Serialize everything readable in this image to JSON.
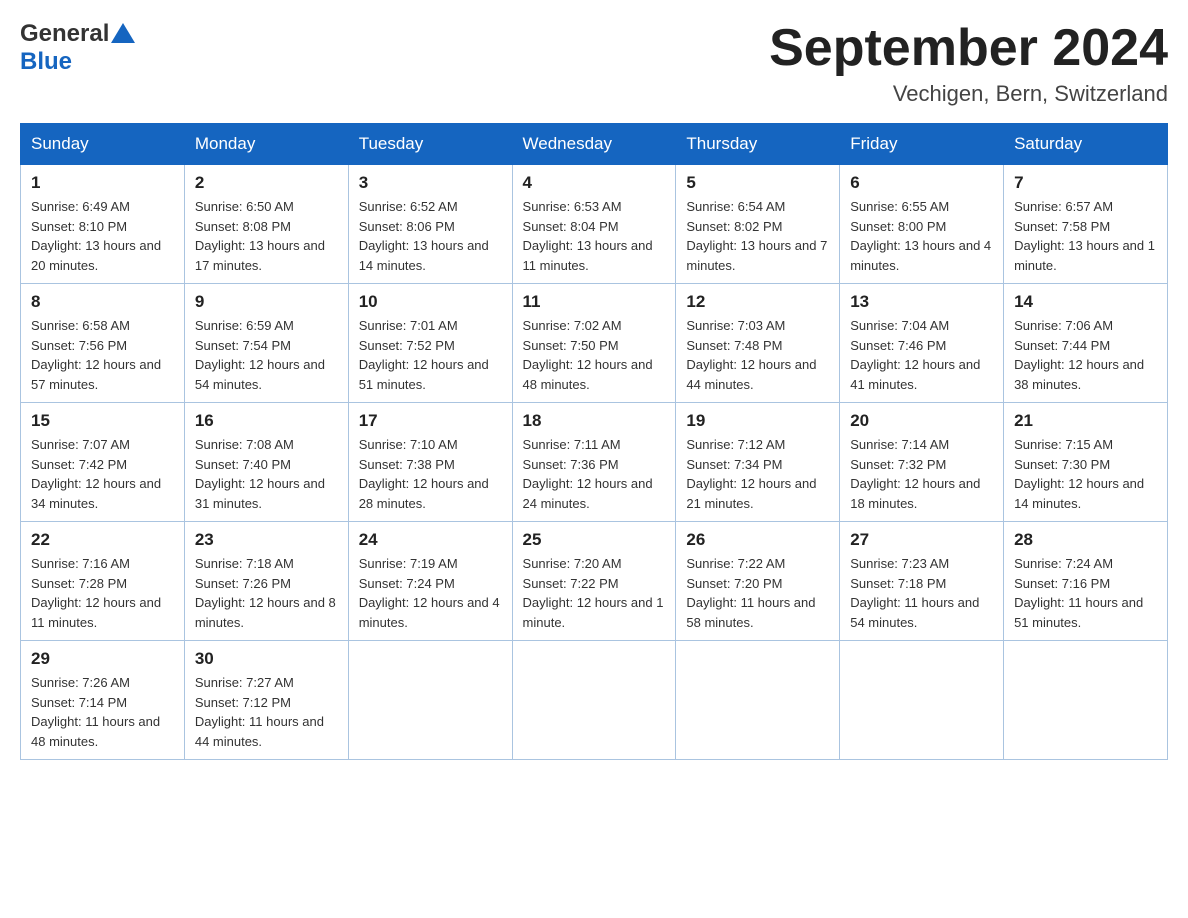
{
  "header": {
    "logo_general": "General",
    "logo_blue": "Blue",
    "title": "September 2024",
    "location": "Vechigen, Bern, Switzerland"
  },
  "days_of_week": [
    "Sunday",
    "Monday",
    "Tuesday",
    "Wednesday",
    "Thursday",
    "Friday",
    "Saturday"
  ],
  "weeks": [
    [
      {
        "day": 1,
        "sunrise": "6:49 AM",
        "sunset": "8:10 PM",
        "daylight": "13 hours and 20 minutes."
      },
      {
        "day": 2,
        "sunrise": "6:50 AM",
        "sunset": "8:08 PM",
        "daylight": "13 hours and 17 minutes."
      },
      {
        "day": 3,
        "sunrise": "6:52 AM",
        "sunset": "8:06 PM",
        "daylight": "13 hours and 14 minutes."
      },
      {
        "day": 4,
        "sunrise": "6:53 AM",
        "sunset": "8:04 PM",
        "daylight": "13 hours and 11 minutes."
      },
      {
        "day": 5,
        "sunrise": "6:54 AM",
        "sunset": "8:02 PM",
        "daylight": "13 hours and 7 minutes."
      },
      {
        "day": 6,
        "sunrise": "6:55 AM",
        "sunset": "8:00 PM",
        "daylight": "13 hours and 4 minutes."
      },
      {
        "day": 7,
        "sunrise": "6:57 AM",
        "sunset": "7:58 PM",
        "daylight": "13 hours and 1 minute."
      }
    ],
    [
      {
        "day": 8,
        "sunrise": "6:58 AM",
        "sunset": "7:56 PM",
        "daylight": "12 hours and 57 minutes."
      },
      {
        "day": 9,
        "sunrise": "6:59 AM",
        "sunset": "7:54 PM",
        "daylight": "12 hours and 54 minutes."
      },
      {
        "day": 10,
        "sunrise": "7:01 AM",
        "sunset": "7:52 PM",
        "daylight": "12 hours and 51 minutes."
      },
      {
        "day": 11,
        "sunrise": "7:02 AM",
        "sunset": "7:50 PM",
        "daylight": "12 hours and 48 minutes."
      },
      {
        "day": 12,
        "sunrise": "7:03 AM",
        "sunset": "7:48 PM",
        "daylight": "12 hours and 44 minutes."
      },
      {
        "day": 13,
        "sunrise": "7:04 AM",
        "sunset": "7:46 PM",
        "daylight": "12 hours and 41 minutes."
      },
      {
        "day": 14,
        "sunrise": "7:06 AM",
        "sunset": "7:44 PM",
        "daylight": "12 hours and 38 minutes."
      }
    ],
    [
      {
        "day": 15,
        "sunrise": "7:07 AM",
        "sunset": "7:42 PM",
        "daylight": "12 hours and 34 minutes."
      },
      {
        "day": 16,
        "sunrise": "7:08 AM",
        "sunset": "7:40 PM",
        "daylight": "12 hours and 31 minutes."
      },
      {
        "day": 17,
        "sunrise": "7:10 AM",
        "sunset": "7:38 PM",
        "daylight": "12 hours and 28 minutes."
      },
      {
        "day": 18,
        "sunrise": "7:11 AM",
        "sunset": "7:36 PM",
        "daylight": "12 hours and 24 minutes."
      },
      {
        "day": 19,
        "sunrise": "7:12 AM",
        "sunset": "7:34 PM",
        "daylight": "12 hours and 21 minutes."
      },
      {
        "day": 20,
        "sunrise": "7:14 AM",
        "sunset": "7:32 PM",
        "daylight": "12 hours and 18 minutes."
      },
      {
        "day": 21,
        "sunrise": "7:15 AM",
        "sunset": "7:30 PM",
        "daylight": "12 hours and 14 minutes."
      }
    ],
    [
      {
        "day": 22,
        "sunrise": "7:16 AM",
        "sunset": "7:28 PM",
        "daylight": "12 hours and 11 minutes."
      },
      {
        "day": 23,
        "sunrise": "7:18 AM",
        "sunset": "7:26 PM",
        "daylight": "12 hours and 8 minutes."
      },
      {
        "day": 24,
        "sunrise": "7:19 AM",
        "sunset": "7:24 PM",
        "daylight": "12 hours and 4 minutes."
      },
      {
        "day": 25,
        "sunrise": "7:20 AM",
        "sunset": "7:22 PM",
        "daylight": "12 hours and 1 minute."
      },
      {
        "day": 26,
        "sunrise": "7:22 AM",
        "sunset": "7:20 PM",
        "daylight": "11 hours and 58 minutes."
      },
      {
        "day": 27,
        "sunrise": "7:23 AM",
        "sunset": "7:18 PM",
        "daylight": "11 hours and 54 minutes."
      },
      {
        "day": 28,
        "sunrise": "7:24 AM",
        "sunset": "7:16 PM",
        "daylight": "11 hours and 51 minutes."
      }
    ],
    [
      {
        "day": 29,
        "sunrise": "7:26 AM",
        "sunset": "7:14 PM",
        "daylight": "11 hours and 48 minutes."
      },
      {
        "day": 30,
        "sunrise": "7:27 AM",
        "sunset": "7:12 PM",
        "daylight": "11 hours and 44 minutes."
      },
      null,
      null,
      null,
      null,
      null
    ]
  ]
}
